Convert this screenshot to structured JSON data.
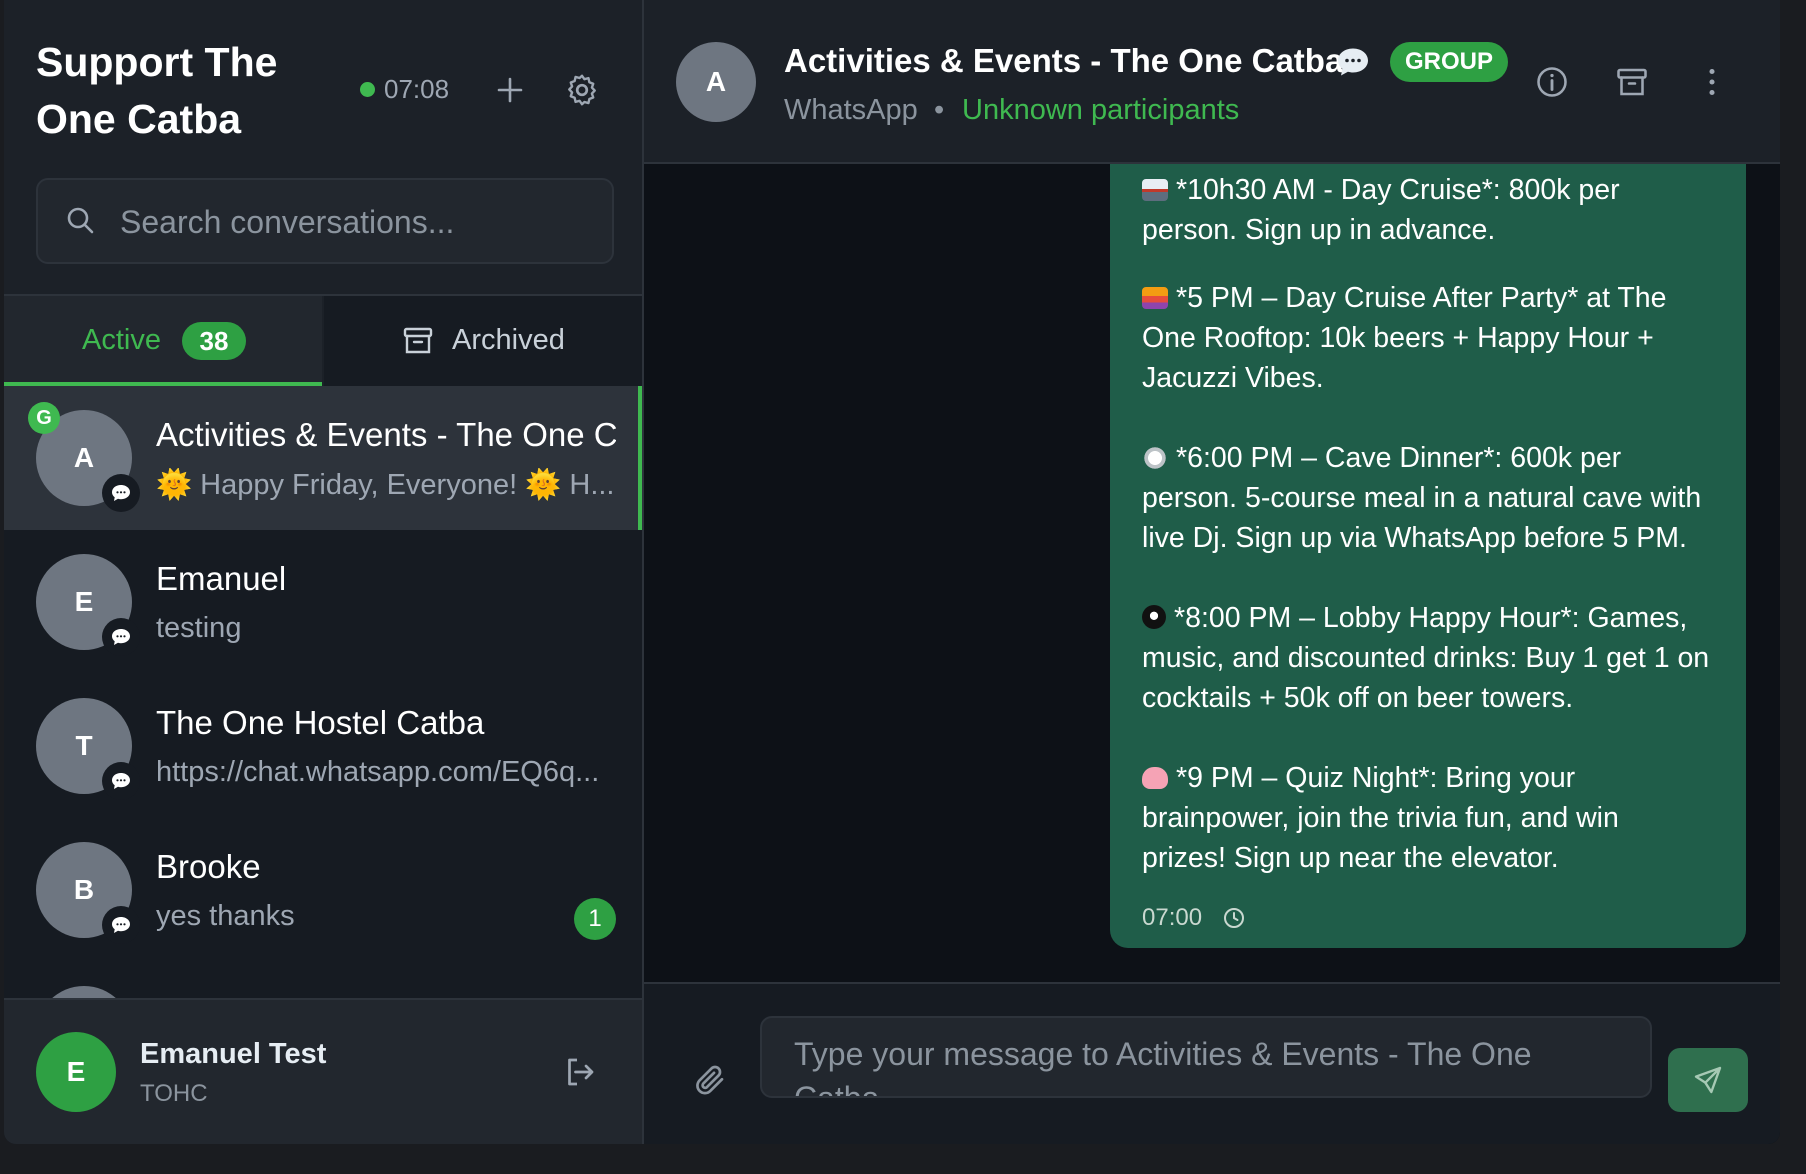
{
  "sidebar": {
    "title": "Support The One Catba",
    "status_time": "07:08",
    "search": {
      "placeholder": "Search conversations..."
    },
    "tabs": {
      "active_label": "Active",
      "active_count": "38",
      "archived_label": "Archived"
    },
    "conversations": [
      {
        "initial": "A",
        "name": "Activities & Events - The One C",
        "preview": "🌞 Happy Friday, Everyone! 🌞 H...",
        "group_badge": "G",
        "selected": true
      },
      {
        "initial": "E",
        "name": "Emanuel",
        "preview": "testing"
      },
      {
        "initial": "T",
        "name": "The One Hostel Catba",
        "preview": "https://chat.whatsapp.com/EQ6q..."
      },
      {
        "initial": "B",
        "name": "Brooke",
        "preview": "yes thanks",
        "unread": "1"
      }
    ],
    "footer": {
      "initial": "E",
      "name": "Emanuel Test",
      "org": "TOHC"
    }
  },
  "chat": {
    "avatar_initial": "A",
    "title": "Activities & Events - The One Catba",
    "group_label": "GROUP",
    "channel": "WhatsApp",
    "separator": "•",
    "participants": "Unknown participants",
    "message": {
      "lines": [
        "*10h30 AM - Day Cruise*: 800k per",
        "person. Sign up in advance.",
        "",
        "*5 PM – Day Cruise After Party* at The",
        "One Rooftop:  10k beers + Happy Hour +",
        "Jacuzzi Vibes.",
        "",
        "*6:00 PM – Cave Dinner*: 600k per",
        "person. 5-course meal in a natural cave with",
        "live Dj. Sign up via WhatsApp before 5 PM.",
        "",
        "*8:00 PM – Lobby Happy Hour*: Games,",
        "music, and discounted drinks: Buy 1 get 1 on",
        "cocktails + 50k off on beer towers.",
        "",
        "*9 PM – Quiz Night*: Bring your",
        "brainpower, join the trivia fun, and win",
        "prizes! Sign up near the elevator."
      ],
      "time": "07:00"
    },
    "composer": {
      "placeholder": "Type your message to Activities & Events - The One Catba..."
    }
  },
  "icons": {
    "status": "status-online-dot",
    "add": "plus-icon",
    "settings": "gear-icon",
    "search": "search-icon",
    "archive": "archive-icon",
    "channel": "chat-bubble-icon",
    "logout": "logout-icon",
    "info": "info-icon",
    "more": "more-vertical-icon",
    "clock": "clock-icon",
    "attach": "paperclip-icon",
    "send": "send-icon"
  },
  "colors": {
    "accent": "#3fb950",
    "bubble": "#1f5d49",
    "sidebar_bg": "#1c2128",
    "chat_bg": "#0d1117"
  }
}
